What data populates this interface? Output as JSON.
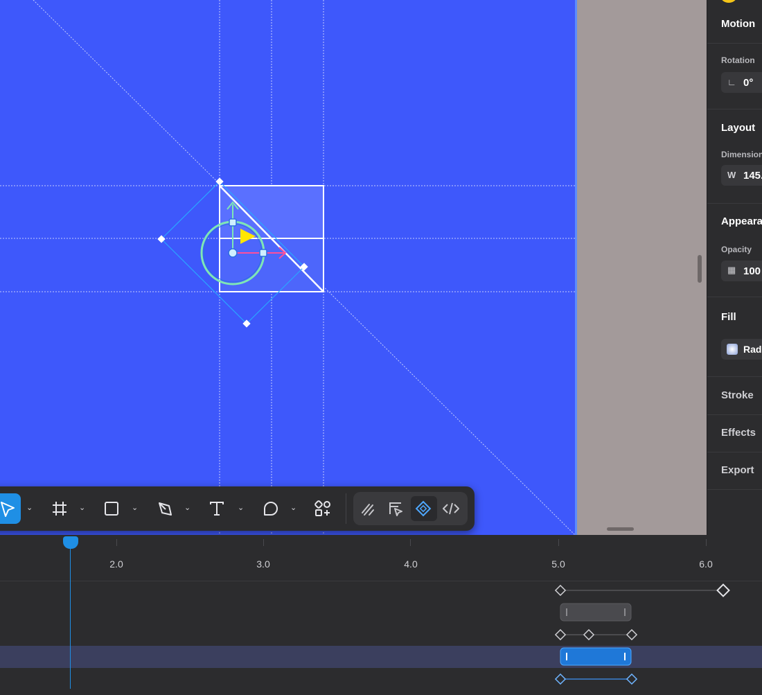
{
  "inspector": {
    "motion": "Motion",
    "rotation_label": "Rotation",
    "rotation_value": "0°",
    "layout": "Layout",
    "dimensions_label": "Dimension",
    "width_prefix": "W",
    "width_value": "145.",
    "appearance": "Appeara",
    "opacity_label": "Opacity",
    "opacity_value": "100",
    "fill": "Fill",
    "fill_type": "Rad",
    "stroke": "Stroke",
    "effects": "Effects",
    "export": "Export"
  },
  "toolbar": {
    "tools": [
      "select-icon",
      "frame-icon",
      "rectangle-icon",
      "pen-icon",
      "text-icon",
      "shape-icon",
      "components-icon"
    ],
    "dev_tools": [
      "draw-icon",
      "inspect-icon",
      "prototype-icon",
      "code-icon"
    ]
  },
  "timeline": {
    "ticks": [
      "2.0",
      "3.0",
      "4.0",
      "5.0",
      "6.0"
    ],
    "playhead_time": 1.66
  },
  "colors": {
    "canvas": "#3e58fb",
    "accent": "#1f8fe5",
    "gizmo_green": "#7ee7b5",
    "gizmo_yellow": "#ffe600",
    "gizmo_pink": "#ff4f9a"
  }
}
